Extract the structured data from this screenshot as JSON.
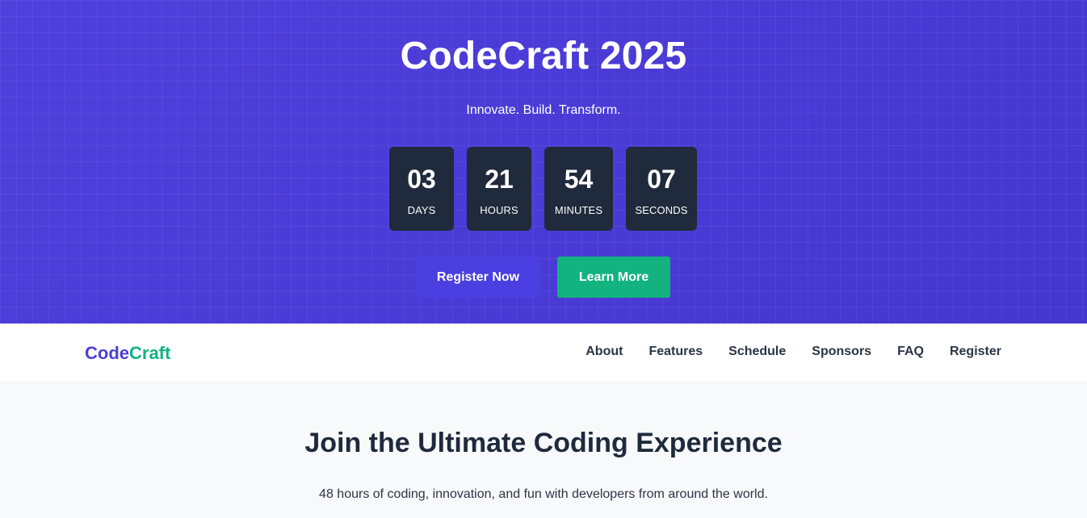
{
  "hero": {
    "title": "CodeCraft 2025",
    "tagline": "Innovate. Build. Transform.",
    "countdown": [
      {
        "value": "03",
        "label": "DAYS"
      },
      {
        "value": "21",
        "label": "HOURS"
      },
      {
        "value": "54",
        "label": "MINUTES"
      },
      {
        "value": "07",
        "label": "SECONDS"
      }
    ],
    "buttons": {
      "register_label": "Register Now",
      "learn_label": "Learn More"
    }
  },
  "navbar": {
    "logo_part1": "Code",
    "logo_part2": "Craft",
    "links": [
      "About",
      "Features",
      "Schedule",
      "Sponsors",
      "FAQ",
      "Register"
    ]
  },
  "intro": {
    "title": "Join the Ultimate Coding Experience",
    "description": "48 hours of coding, innovation, and fun with developers from around the world."
  },
  "colors": {
    "hero_bg": "#4d3ed8",
    "countdown_bg": "#1f2a3c",
    "primary": "#4a3fe0",
    "accent": "#12b37f",
    "page_bg": "#f8f9fb"
  }
}
